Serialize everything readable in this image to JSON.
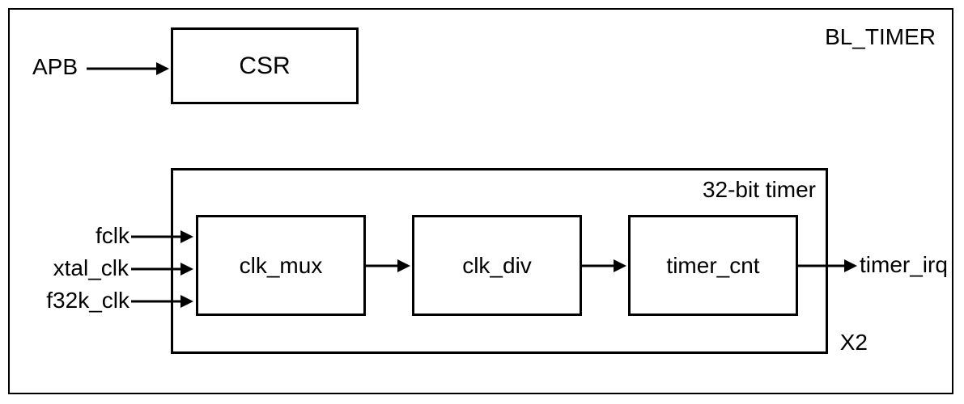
{
  "title": "BL_TIMER",
  "csr": {
    "label": "CSR",
    "input": "APB"
  },
  "timer": {
    "title": "32-bit timer",
    "multiplier": "X2",
    "blocks": {
      "mux": "clk_mux",
      "div": "clk_div",
      "cnt": "timer_cnt"
    },
    "inputs": [
      "fclk",
      "xtal_clk",
      "f32k_clk"
    ],
    "output": "timer_irq"
  }
}
